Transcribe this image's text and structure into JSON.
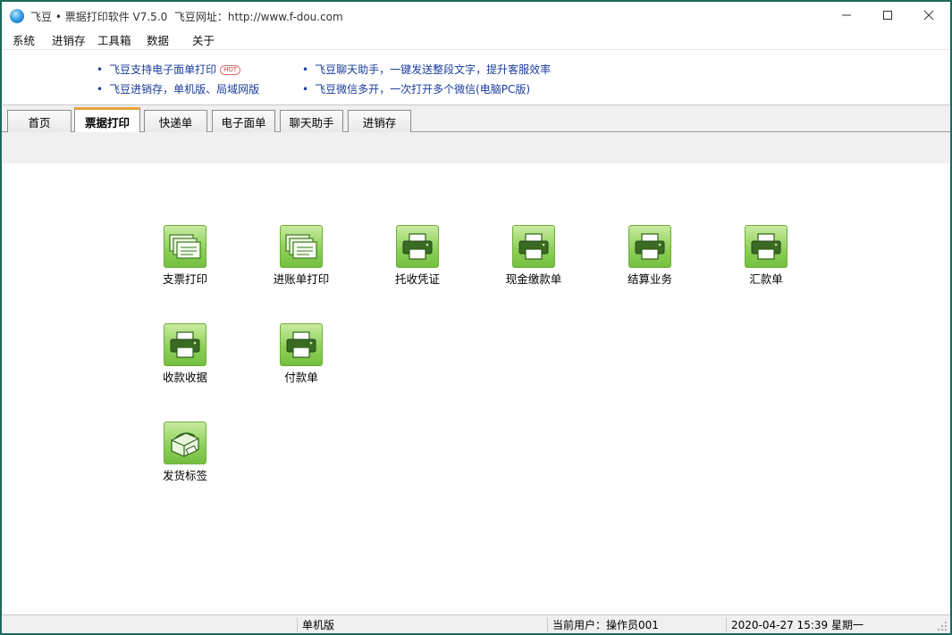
{
  "window": {
    "title": "飞豆 • 票据打印软件 V7.5.0  飞豆网址：http://www.f-dou.com"
  },
  "menu": [
    "系统",
    "进销存",
    "工具箱",
    "数据",
    "关于"
  ],
  "news": {
    "items": [
      {
        "text": "飞豆支持电子面单打印",
        "badge": "HOT"
      },
      {
        "text": "飞豆进销存，单机版、局域网版"
      },
      {
        "text": "飞豆聊天助手，一键发送整段文字，提升客服效率"
      },
      {
        "text": "飞豆微信多开，一次打开多个微信(电脑PC版)"
      }
    ]
  },
  "tabs": [
    {
      "label": "首页",
      "active": false
    },
    {
      "label": "票据打印",
      "active": true
    },
    {
      "label": "快递单",
      "active": false
    },
    {
      "label": "电子面单",
      "active": false
    },
    {
      "label": "聊天助手",
      "active": false
    },
    {
      "label": "进销存",
      "active": false
    }
  ],
  "tiles": [
    {
      "label": "支票打印",
      "icon": "forms-stack-icon"
    },
    {
      "label": "进账单打印",
      "icon": "forms-stack-icon"
    },
    {
      "label": "托收凭证",
      "icon": "printer-icon"
    },
    {
      "label": "现金缴款单",
      "icon": "printer-icon"
    },
    {
      "label": "结算业务",
      "icon": "printer-icon"
    },
    {
      "label": "汇款单",
      "icon": "printer-icon"
    },
    {
      "label": "收款收据",
      "icon": "printer-icon"
    },
    {
      "label": "付款单",
      "icon": "printer-icon"
    },
    {
      "label": "发货标签",
      "icon": "label-printer-icon"
    }
  ],
  "status": {
    "mode": "单机版",
    "user": "当前用户：操作员001",
    "datetime": "2020-04-27 15:39 星期一"
  },
  "colors": {
    "window_border": "#1a6b5c",
    "tab_active_accent": "#e8a23a",
    "link": "#1a3d9b",
    "tile_green": "#8fd05a"
  }
}
